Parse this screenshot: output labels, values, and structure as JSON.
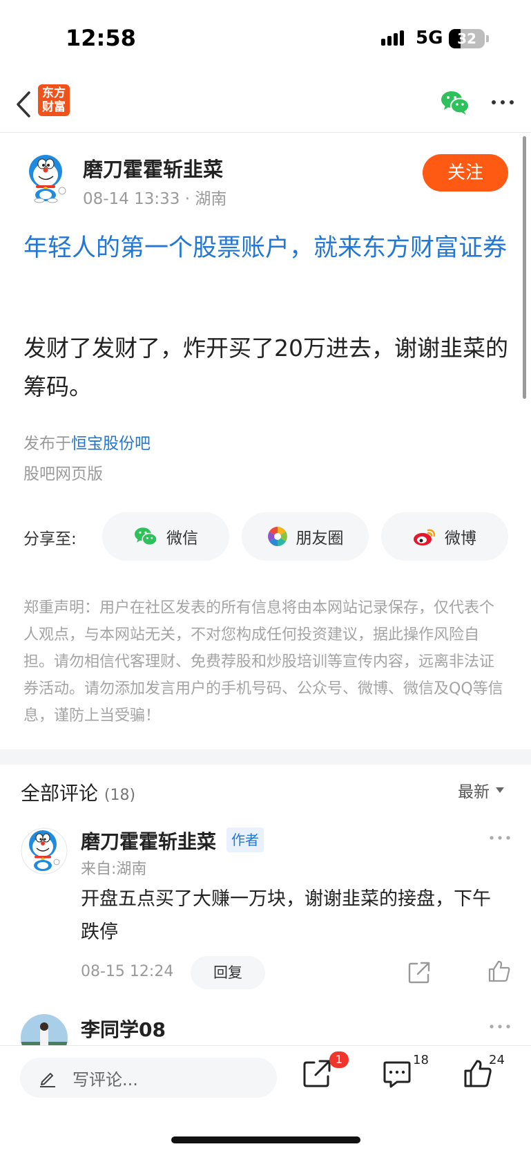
{
  "status_bar": {
    "time": "12:58",
    "network": "5G",
    "battery": "32",
    "battery_level": 0.32
  },
  "nav": {
    "logo_line1": "东方",
    "logo_line2": "财富",
    "brand_color": "#f0521b",
    "icons": [
      "back-chevron-icon",
      "wechat-icon",
      "more-icon"
    ]
  },
  "post": {
    "author_name": "磨刀霍霍斩韭菜",
    "meta": "08-14 13:33 · 湖南",
    "follow_label": "关注",
    "title": "年轻人的第一个股票账户，就来东方财富证券",
    "body": "发财了发财了，炸开买了20万进去，谢谢韭菜的筹码。",
    "published_prefix": "发布于",
    "published_bar": "恒宝股份吧",
    "source": "股吧网页版",
    "link_color": "#2377d4",
    "accent_color": "#ff5a14"
  },
  "share": {
    "label": "分享至:",
    "wechat": "微信",
    "moments": "朋友圈",
    "weibo": "微博"
  },
  "disclaimer": "郑重声明：用户在社区发表的所有信息将由本网站记录保存，仅代表个人观点，与本网站无关，不对您构成任何投资建议，据此操作风险自担。请勿相信代客理财、免费荐股和炒股培训等宣传内容，远离非法证券活动。请勿添加发言用户的手机号码、公众号、微博、微信及QQ等信息，谨防上当受骗！",
  "comments": {
    "title": "全部评论",
    "count": "(18)",
    "sort_label": "最新",
    "items": [
      {
        "name": "磨刀霍霍斩韭菜",
        "badge": "作者",
        "from": "来自:湖南",
        "text": "开盘五点买了大赚一万块，谢谢韭菜的接盘，下午跌停",
        "time": "08-15 12:24",
        "reply_label": "回复"
      },
      {
        "name": "李同学08"
      }
    ]
  },
  "bottom_bar": {
    "input_placeholder": "写评论...",
    "share_badge": "1",
    "comment_count": "18",
    "like_count": "24"
  }
}
